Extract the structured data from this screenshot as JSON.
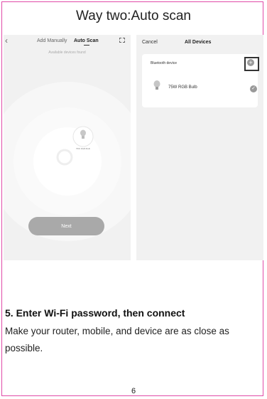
{
  "heading": "Way two:Auto scan",
  "left_screen": {
    "back_glyph": "‹",
    "tab_manual": "Add Manually",
    "tab_auto": "Auto Scan",
    "found_text": "Available devices found",
    "device_label": "75W RGB Bulb",
    "next_label": "Next"
  },
  "right_screen": {
    "cancel_label": "Cancel",
    "title": "All Devices",
    "section_label": "Bluetooth device",
    "add_glyph": "+",
    "device_name": "75W RGB Bulb",
    "check_glyph": "✓"
  },
  "step": {
    "title": "5. Enter Wi-Fi password, then connect",
    "body": "Make your router, mobile, and device are as close as possible."
  },
  "page_number": "6",
  "colors": {
    "border": "#e04aa8",
    "panel_bg": "#f1f1f1",
    "button": "#a9a9a9"
  }
}
